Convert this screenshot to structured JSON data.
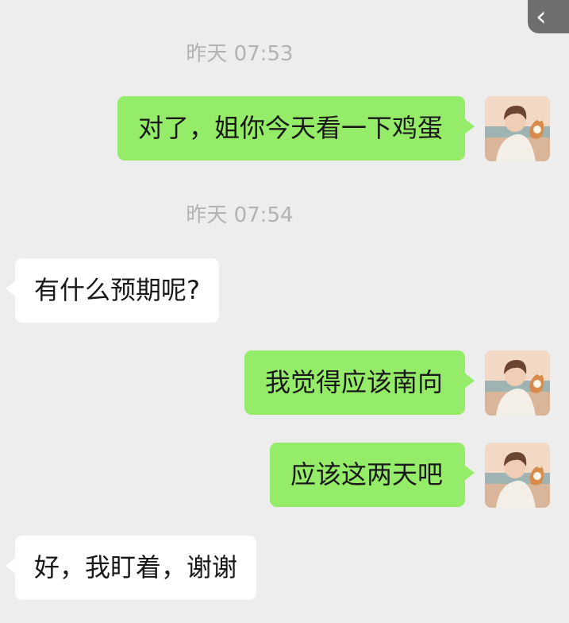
{
  "header": {
    "back_icon": "‹"
  },
  "messages": [
    {
      "type": "timestamp",
      "text": "昨天 07:53"
    },
    {
      "type": "sent",
      "text": "对了，姐你今天看一下鸡蛋"
    },
    {
      "type": "timestamp",
      "text": "昨天 07:54"
    },
    {
      "type": "received",
      "text": "有什么预期呢?"
    },
    {
      "type": "sent",
      "text": "我觉得应该南向"
    },
    {
      "type": "sent",
      "text": "应该这两天吧"
    },
    {
      "type": "received",
      "text": "好，我盯着，谢谢"
    }
  ],
  "colors": {
    "background": "#ededed",
    "sent_bubble": "#95ec69",
    "received_bubble": "#ffffff",
    "timestamp": "#b3b3b3"
  },
  "icons": {
    "avatar": "anime-boy-with-dog-avatar"
  }
}
